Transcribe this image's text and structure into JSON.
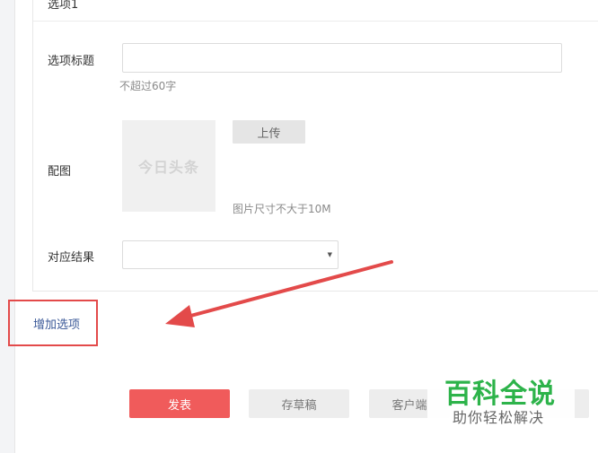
{
  "option": {
    "header": "选项1",
    "title_label": "选项标题",
    "title_value": "",
    "title_hint": "不超过60字",
    "image_label": "配图",
    "image_placeholder_logo": "今日头条",
    "upload_label": "上传",
    "image_hint": "图片尺寸不大于10M",
    "result_label": "对应结果",
    "result_value": ""
  },
  "add_option_label": "增加选项",
  "actions": {
    "publish": "发表",
    "draft": "存草稿",
    "client": "客户端"
  },
  "watermark": {
    "title": "百科全说",
    "subtitle": "助你轻松解决"
  },
  "colors": {
    "publish": "#f05b5b",
    "highlight_box": "#e34a4a",
    "link": "#3b5998",
    "watermark_green": "#2db34a"
  }
}
